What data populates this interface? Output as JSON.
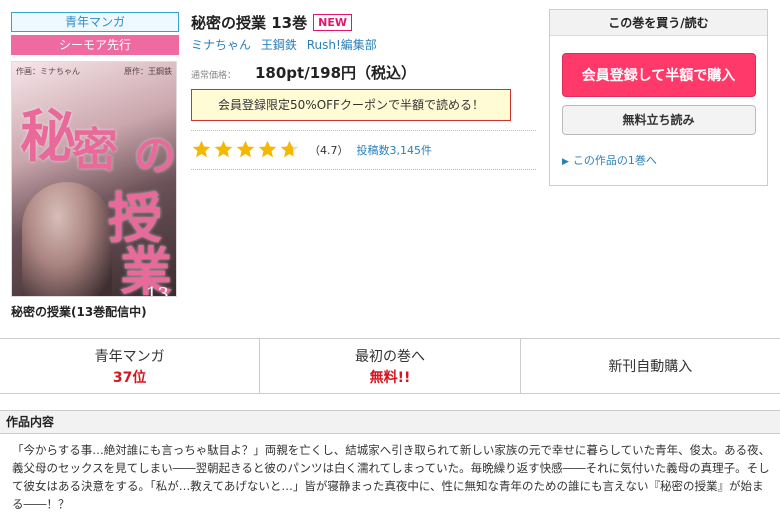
{
  "left": {
    "genre_badge": "青年マンガ",
    "simoa_badge": "シーモア先行",
    "cover": {
      "credit_left": "作画：ミナちゃん",
      "credit_right": "原作：王鋼鉄",
      "title_chars": [
        "秘",
        "密",
        "の",
        "授",
        "業"
      ],
      "volume_number": "13"
    },
    "caption": "秘密の授業(13巻配信中)"
  },
  "main": {
    "title": "秘密の授業 13巻",
    "new_badge": "NEW",
    "authors": [
      "ミナちゃん",
      "王鋼鉄",
      "Rush!編集部"
    ],
    "price_label": "通常価格：",
    "price": "180pt/198円（税込）",
    "coupon": "会員登録限定50%OFFクーポンで半額で読める！",
    "rating": {
      "value": 4.7,
      "score_text": "（4.7）",
      "reviews_text": "投稿数3,145件"
    }
  },
  "buy_box": {
    "header": "この巻を買う/読む",
    "buy_button": "会員登録して半額で購入",
    "read_button": "無料立ち読み",
    "first_volume_link": "この作品の1巻へ"
  },
  "stats": [
    {
      "label": "青年マンガ",
      "value": "37位"
    },
    {
      "label": "最初の巻へ",
      "value": "無料!!"
    },
    {
      "label": "新刊自動購入",
      "value": ""
    }
  ],
  "description": {
    "heading": "作品内容",
    "text": "「今からする事…絶対誰にも言っちゃ駄目よ？」両親を亡くし、結城家へ引き取られて新しい家族の元で幸せに暮らしていた青年、俊太。ある夜、義父母のセックスを見てしまい――翌朝起きると彼のパンツは白く濡れてしまっていた。毎晩繰り返す快感――それに気付いた義母の真理子。そして彼女はある決意をする。「私が…教えてあげないと…」皆が寝静まった真夜中に、性に無知な青年のための誰にも言えない『秘密の授業』が始まる――！？"
  },
  "colors": {
    "accent_pink": "#ff3a6a",
    "link_blue": "#2980b9",
    "star_yellow": "#f5b800",
    "rank_red": "#d9141f"
  }
}
